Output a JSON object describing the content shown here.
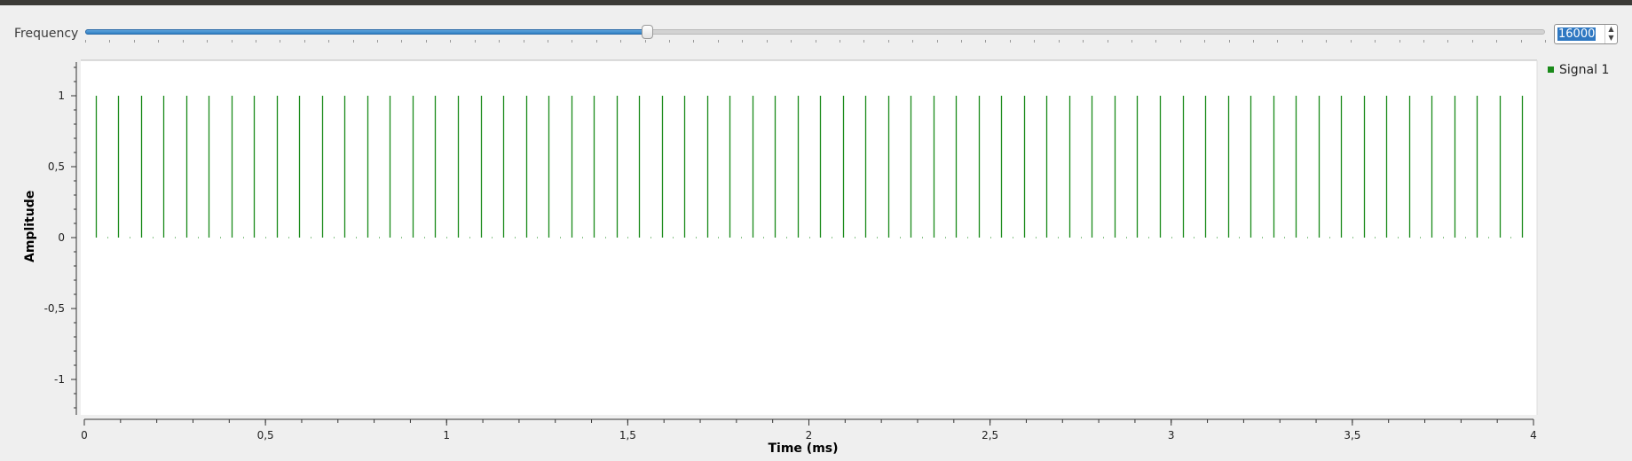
{
  "control": {
    "label": "Frequency",
    "value": "16000",
    "slider_fraction": 0.385
  },
  "legend": {
    "items": [
      {
        "name": "Signal 1",
        "color": "#1a8a1a"
      }
    ]
  },
  "chart_data": {
    "type": "line",
    "xlabel": "Time (ms)",
    "ylabel": "Amplitude",
    "xlim": [
      0,
      4
    ],
    "ylim": [
      -1.25,
      1.25
    ],
    "x_ticks": [
      "0",
      "0,5",
      "1",
      "1,5",
      "2",
      "2,5",
      "3",
      "3,5",
      "4"
    ],
    "y_ticks": [
      "1",
      "0,5",
      "0",
      "-0,5",
      "-1"
    ],
    "grid": false,
    "legend_position": "right",
    "series": [
      {
        "name": "Signal 1",
        "color": "#1a8a1a",
        "style": "impulse train",
        "pulse_period_ms": 0.0625,
        "first_pulse_ms": 0.03125,
        "pulse_amplitude": 1,
        "baseline": 0
      }
    ]
  }
}
